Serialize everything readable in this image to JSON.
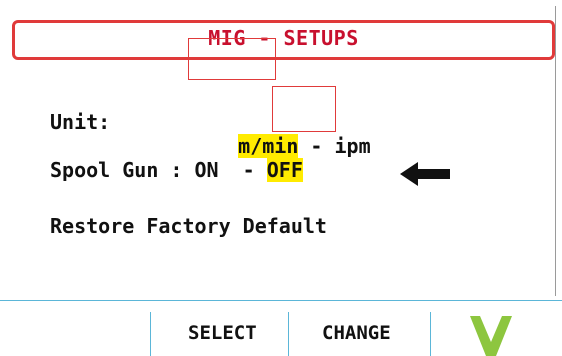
{
  "header": {
    "title": "MIG - SETUPS"
  },
  "settings": {
    "unit": {
      "label": "Unit:",
      "option_a": "m/min",
      "separator": " - ",
      "option_b": "ipm",
      "selected": "m/min"
    },
    "spool_gun": {
      "label": "Spool Gun : ON  - ",
      "option_b": "OFF",
      "selected": "OFF"
    },
    "restore": {
      "label": "Restore Factory Default"
    }
  },
  "footer": {
    "select_label": "SELECT",
    "change_label": "CHANGE"
  },
  "colors": {
    "highlight": "#ffeb00",
    "title": "#c8102e",
    "accent_line": "#5bb6d8",
    "check": "#8dc63f",
    "annotation": "#e03a3a"
  },
  "icons": {
    "cursor": "arrow-left-icon",
    "confirm": "checkmark-icon"
  }
}
